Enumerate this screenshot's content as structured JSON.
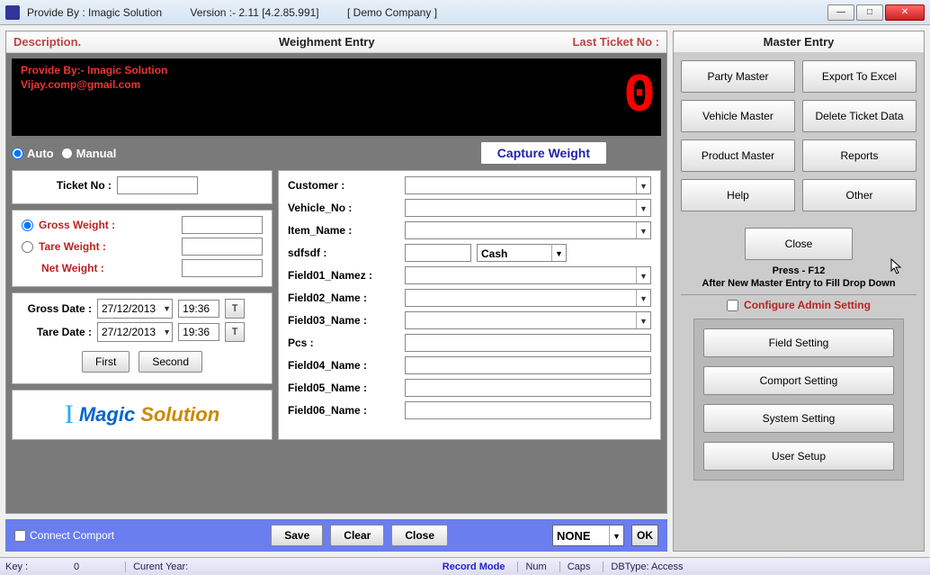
{
  "titlebar": {
    "provide": "Provide By : Imagic Solution",
    "version": "Version :- 2.11 [4.2.85.991]",
    "company": "[ Demo Company ]"
  },
  "left": {
    "header": {
      "desc": "Description.",
      "title": "Weighment Entry",
      "last": "Last Ticket No :"
    },
    "display": {
      "line1": "Provide By:- Imagic Solution",
      "line2": "Vijay.comp@gmail.com",
      "digit": "0"
    },
    "mode": {
      "auto": "Auto",
      "manual": "Manual",
      "capture": "Capture Weight"
    },
    "ticket": {
      "label": "Ticket No :"
    },
    "weights": {
      "gross": "Gross Weight :",
      "tare": "Tare Weight  :",
      "net": "Net Weight :"
    },
    "dates": {
      "grossLbl": "Gross Date :",
      "gross": "27/12/2013",
      "grossTime": "19:36",
      "t": "T",
      "tareLbl": "Tare Date :",
      "tare": "27/12/2013",
      "tareTime": "19:36"
    },
    "navBtns": {
      "first": "First",
      "second": "Second"
    },
    "logo": {
      "i": "I",
      "magic": "Magic",
      "sol": "Solution"
    },
    "fields": {
      "customer": "Customer :",
      "vehicle": "Vehicle_No :",
      "item": "Item_Name :",
      "sdf": "sdfsdf :",
      "cash": "Cash",
      "f1": "Field01_Namez :",
      "f2": "Field02_Name :",
      "f3": "Field03_Name :",
      "pcs": "Pcs :",
      "f4": "Field04_Name :",
      "f5": "Field05_Name :",
      "f6": "Field06_Name :"
    },
    "actions": {
      "connect": "Connect Comport",
      "save": "Save",
      "clear": "Clear",
      "close": "Close",
      "none": "NONE",
      "ok": "OK"
    }
  },
  "right": {
    "title": "Master Entry",
    "btns": {
      "party": "Party Master",
      "export": "Export To Excel",
      "vehicle": "Vehicle Master",
      "delete": "Delete Ticket Data",
      "product": "Product Master",
      "reports": "Reports",
      "help": "Help",
      "other": "Other"
    },
    "close": "Close",
    "press1": "Press - F12",
    "press2": "After New Master Entry to Fill Drop Down",
    "config": "Configure Admin Setting",
    "settings": {
      "field": "Field Setting",
      "comport": "Comport Setting",
      "system": "System Setting",
      "user": "User Setup"
    }
  },
  "status": {
    "key": "Key :",
    "keyVal": "0",
    "year": "Curent Year:",
    "rec": "Record Mode",
    "num": "Num",
    "caps": "Caps",
    "db": "DBType: Access"
  }
}
